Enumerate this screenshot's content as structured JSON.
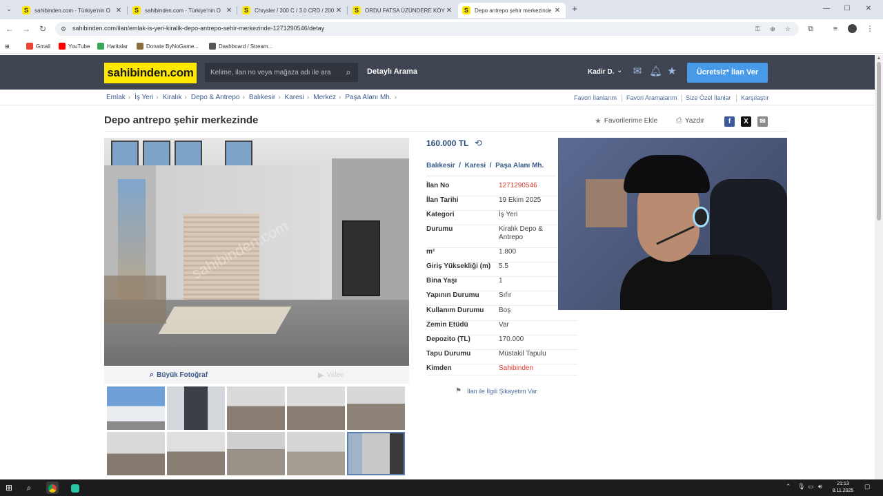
{
  "browser": {
    "tabs": [
      {
        "title": "sahibinden.com - Türkiye'nin O",
        "active": false
      },
      {
        "title": "sahibinden.com - Türkiye'nin O",
        "active": false
      },
      {
        "title": "Chrysler / 300 C / 3.0 CRD / 200",
        "active": false
      },
      {
        "title": "ORDU FATSA ÜZÜNDERE KÖYÜ",
        "active": false
      },
      {
        "title": "Depo antrepo şehir merkezinde",
        "active": true
      }
    ],
    "favicon_letter": "S",
    "new_tab": "+",
    "url": "sahibinden.com/ilan/emlak-is-yeri-kiralik-depo-antrepo-sehir-merkezinde-1271290546/detay",
    "bookmarks": [
      {
        "label": "Gmail",
        "color": "#ea4335"
      },
      {
        "label": "YouTube",
        "color": "#ff0000"
      },
      {
        "label": "Haritalar",
        "color": "#34a853"
      },
      {
        "label": "Donate ByNoGame...",
        "color": "#8a6d3b"
      },
      {
        "label": "Dashboard / Stream...",
        "color": "#555555"
      }
    ]
  },
  "header": {
    "logo": "sahibinden.com",
    "search_placeholder": "Kelime, ilan no veya mağaza adı ile ara",
    "advanced_search": "Detaylı Arama",
    "user": "Kadir D.",
    "post_button": "Ücretsiz* İlan Ver",
    "colors": {
      "header_bg": "#3e4450",
      "logo_yellow": "#ffe800",
      "post_blue": "#489ae9"
    }
  },
  "breadcrumb": [
    "Emlak",
    "İş Yeri",
    "Kiralık",
    "Depo & Antrepo",
    "Balıkesir",
    "Karesi",
    "Merkez",
    "Paşa Alanı Mh."
  ],
  "top_links": [
    "Favori İlanlarım",
    "Favori Aramalarım",
    "Size Özel İlanlar",
    "Karşılaştır"
  ],
  "listing": {
    "title": "Depo antrepo şehir merkezinde",
    "add_favorite": "Favorilerime Ekle",
    "print": "Yazdır",
    "share": [
      "f",
      "X",
      "✉"
    ],
    "photo_watermark": "sahibinden.com",
    "big_photo": "Büyük Fotoğraf",
    "video": "Video",
    "price": "160.000 TL",
    "location": [
      "Balıkesir",
      "Karesi",
      "Paşa Alanı Mh."
    ],
    "details": [
      {
        "label": "İlan No",
        "value": "1271290546",
        "highlight": true
      },
      {
        "label": "İlan Tarihi",
        "value": "19 Ekim 2025"
      },
      {
        "label": "Kategori",
        "value": "İş Yeri"
      },
      {
        "label": "Durumu",
        "value": "Kiralık Depo & Antrepo"
      },
      {
        "label": "m²",
        "value": "1.800"
      },
      {
        "label": "Giriş Yüksekliği (m)",
        "value": "5.5"
      },
      {
        "label": "Bina Yaşı",
        "value": "1"
      },
      {
        "label": "Yapının Durumu",
        "value": "Sıfır"
      },
      {
        "label": "Kullanım Durumu",
        "value": "Boş"
      },
      {
        "label": "Zemin Etüdü",
        "value": "Var"
      },
      {
        "label": "Depozito (TL)",
        "value": "170.000"
      },
      {
        "label": "Tapu Durumu",
        "value": "Müstakil Tapulu"
      },
      {
        "label": "Kimden",
        "value": "Sahibinden",
        "highlight": true
      }
    ],
    "complaint": "İlan ile İlgili Şikayetim Var",
    "thumbnail_count": 10,
    "selected_thumbnail": 10
  },
  "taskbar": {
    "time": "21:13",
    "date": "8.11.2025"
  }
}
